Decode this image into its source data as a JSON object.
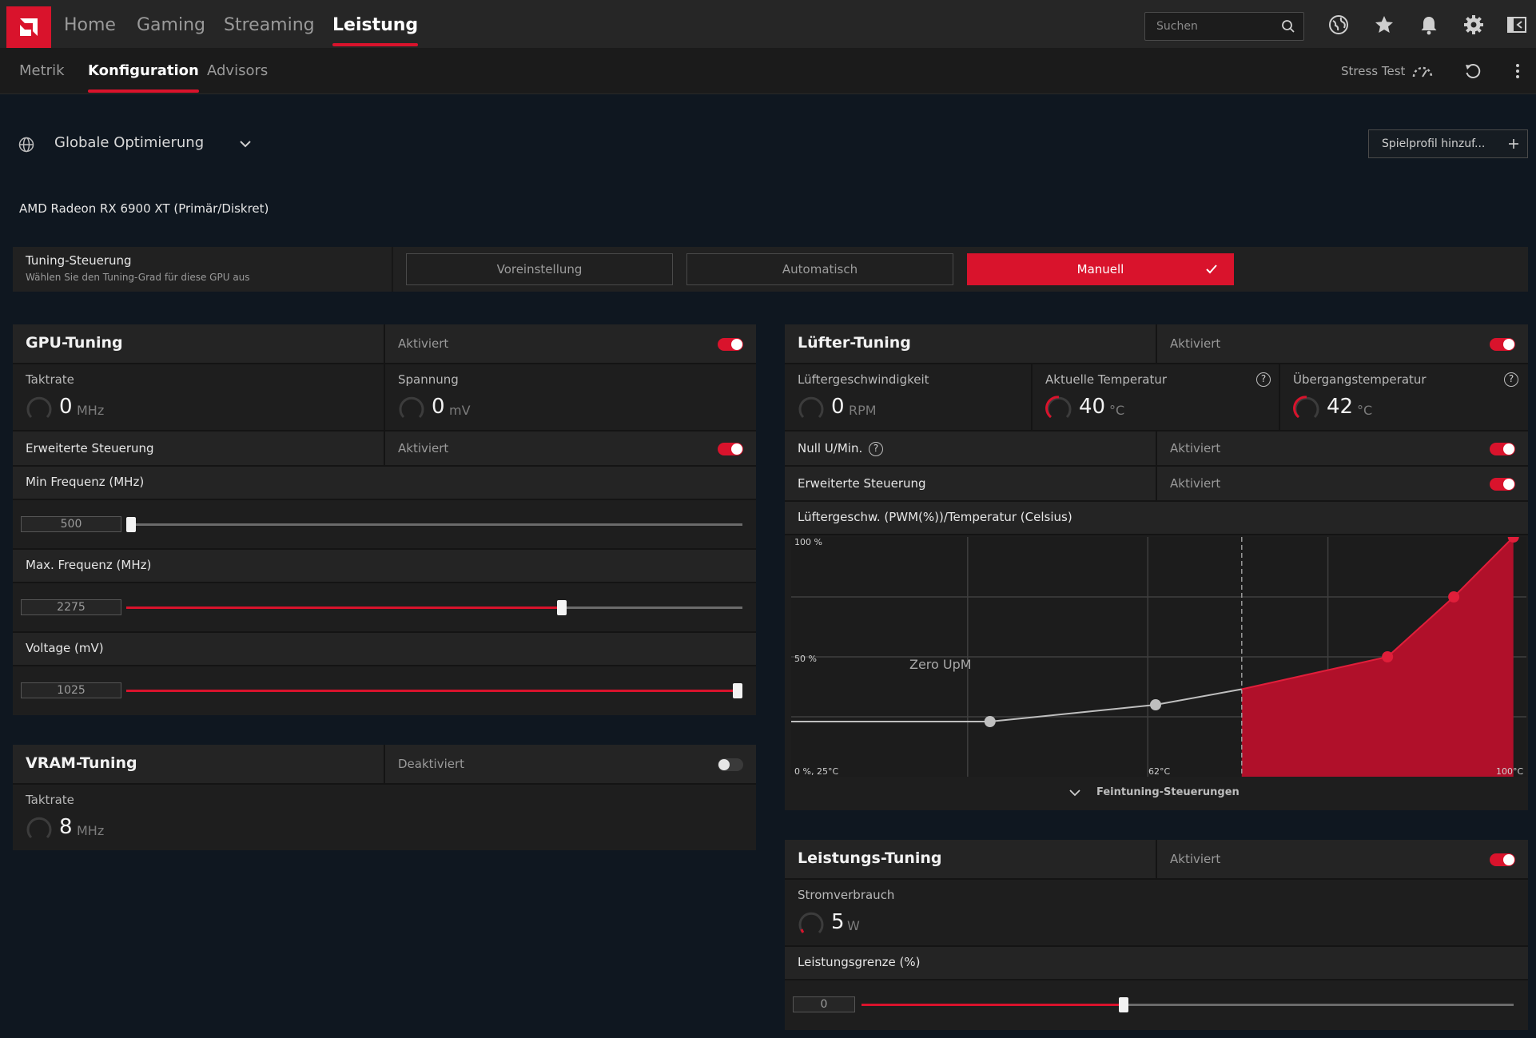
{
  "topbar": {
    "nav": [
      "Home",
      "Gaming",
      "Streaming",
      "Leistung"
    ],
    "search_placeholder": "Suchen",
    "icons": [
      "globe-icon",
      "star-icon",
      "bell-icon",
      "gear-icon",
      "sidebar-toggle-icon"
    ]
  },
  "subbar": {
    "tabs": [
      "Metrik",
      "Konfiguration",
      "Advisors"
    ],
    "stress_test": "Stress Test"
  },
  "profile": {
    "label": "Globale Optimierung",
    "add_button": "Spielprofil hinzuf..."
  },
  "gpu_name": "AMD Radeon RX 6900 XT (Primär/Diskret)",
  "tuning_control": {
    "label": "Tuning-Steuerung",
    "sub": "Wählen Sie den Tuning-Grad für diese GPU aus",
    "options": [
      "Voreinstellung",
      "Automatisch",
      "Manuell"
    ],
    "selected": "Manuell"
  },
  "gpu_tuning": {
    "title": "GPU-Tuning",
    "state": "Aktiviert",
    "enabled": true,
    "clock": {
      "label": "Taktrate",
      "value": "0",
      "unit": "MHz"
    },
    "voltage": {
      "label": "Spannung",
      "value": "0",
      "unit": "mV"
    },
    "advanced": {
      "label": "Erweiterte Steuerung",
      "state": "Aktiviert",
      "enabled": true
    },
    "min_freq": {
      "label": "Min Frequenz (MHz)",
      "value": "500",
      "fraction": 0.0
    },
    "max_freq": {
      "label": "Max. Frequenz (MHz)",
      "value": "2275",
      "fraction": 0.707
    },
    "voltage_slider": {
      "label": "Voltage (mV)",
      "value": "1025",
      "fraction": 1.0
    }
  },
  "vram_tuning": {
    "title": "VRAM-Tuning",
    "state": "Deaktiviert",
    "enabled": false,
    "clock": {
      "label": "Taktrate",
      "value": "8",
      "unit": "MHz"
    }
  },
  "fan_tuning": {
    "title": "Lüfter-Tuning",
    "state": "Aktiviert",
    "enabled": true,
    "speed": {
      "label": "Lüftergeschwindigkeit",
      "value": "0",
      "unit": "RPM"
    },
    "current_temp": {
      "label": "Aktuelle Temperatur",
      "value": "40",
      "unit": "°C"
    },
    "junction_temp": {
      "label": "Übergangstemperatur",
      "value": "42",
      "unit": "°C"
    },
    "zero_rpm": {
      "label": "Null U/Min.",
      "state": "Aktiviert",
      "enabled": true
    },
    "advanced": {
      "label": "Erweiterte Steuerung",
      "state": "Aktiviert",
      "enabled": true
    },
    "curve_label": "Lüftergeschw. (PWM(%))/Temperatur (Celsius)",
    "fine_tune": "Feintuning-Steuerungen"
  },
  "power_tuning": {
    "title": "Leistungs-Tuning",
    "state": "Aktiviert",
    "enabled": true,
    "power": {
      "label": "Stromverbrauch",
      "value": "5",
      "unit": "W"
    },
    "limit": {
      "label": "Leistungsgrenze (%)",
      "value": "0",
      "fraction": 0.5
    }
  },
  "chart_data": {
    "type": "line",
    "title": "",
    "y_tick_labels": [
      "100 %",
      "50 %"
    ],
    "x_tick_labels": [
      "62°C",
      "100°C"
    ],
    "origin_label": "0 %, 25°C",
    "annotation": "Zero UpM",
    "x": [
      30,
      55,
      68,
      90,
      100,
      109
    ],
    "y": [
      23,
      30,
      36.5,
      50,
      75,
      100
    ],
    "colors": {
      "active": "#c8102e",
      "inactive": "#bfbfbf"
    }
  }
}
